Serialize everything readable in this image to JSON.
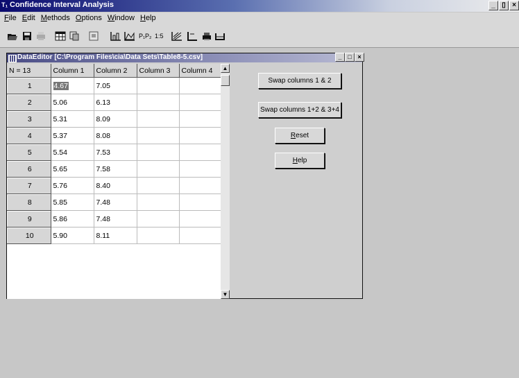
{
  "app": {
    "title": "Confidence Interval Analysis",
    "icon_text": "T₁"
  },
  "menu": [
    {
      "label": "File",
      "key": "F",
      "rest": "ile"
    },
    {
      "label": "Edit",
      "key": "E",
      "rest": "dit"
    },
    {
      "label": "Methods",
      "key": "M",
      "rest": "ethods"
    },
    {
      "label": "Options",
      "key": "O",
      "rest": "ptions"
    },
    {
      "label": "Window",
      "key": "W",
      "rest": "indow"
    },
    {
      "label": "Help",
      "key": "H",
      "rest": "elp"
    }
  ],
  "toolbar": {
    "items": [
      "open-icon",
      "save-icon",
      "print-icon",
      "table-icon",
      "copy-icon",
      "preview-icon",
      "bar-chart-icon",
      "area-chart-icon",
      "pp-icon",
      "ratio-icon",
      "scatter-icon",
      "axes-icon",
      "printer-icon",
      "scale-icon"
    ],
    "pp_label": "P₁P₂",
    "ratio_label": "1:5"
  },
  "window_controls": {
    "minimize": "_",
    "restore": "B",
    "close": "×"
  },
  "data_editor": {
    "title": "DataEditor  [C:\\Program Files\\cia\\Data Sets\\Table8-5.csv]",
    "n_label": "N = 13",
    "columns": [
      "Column 1",
      "Column 2",
      "Column 3",
      "Column 4"
    ],
    "rows": [
      {
        "n": "1",
        "c1": "4.67",
        "c2": "7.05",
        "c3": "",
        "c4": ""
      },
      {
        "n": "2",
        "c1": "5.06",
        "c2": "6.13",
        "c3": "",
        "c4": ""
      },
      {
        "n": "3",
        "c1": "5.31",
        "c2": "8.09",
        "c3": "",
        "c4": ""
      },
      {
        "n": "4",
        "c1": "5.37",
        "c2": "8.08",
        "c3": "",
        "c4": ""
      },
      {
        "n": "5",
        "c1": "5.54",
        "c2": "7.53",
        "c3": "",
        "c4": ""
      },
      {
        "n": "6",
        "c1": "5.65",
        "c2": "7.58",
        "c3": "",
        "c4": ""
      },
      {
        "n": "7",
        "c1": "5.76",
        "c2": "8.40",
        "c3": "",
        "c4": ""
      },
      {
        "n": "8",
        "c1": "5.85",
        "c2": "7.48",
        "c3": "",
        "c4": ""
      },
      {
        "n": "9",
        "c1": "5.86",
        "c2": "7.48",
        "c3": "",
        "c4": ""
      },
      {
        "n": "10",
        "c1": "5.90",
        "c2": "8.11",
        "c3": "",
        "c4": ""
      }
    ],
    "buttons": {
      "swap12": "Swap columns 1 & 2",
      "swap1234": "Swap columns 1+2 & 3+4",
      "reset_key": "R",
      "reset_rest": "eset",
      "help_key": "H",
      "help_rest": "elp"
    }
  }
}
